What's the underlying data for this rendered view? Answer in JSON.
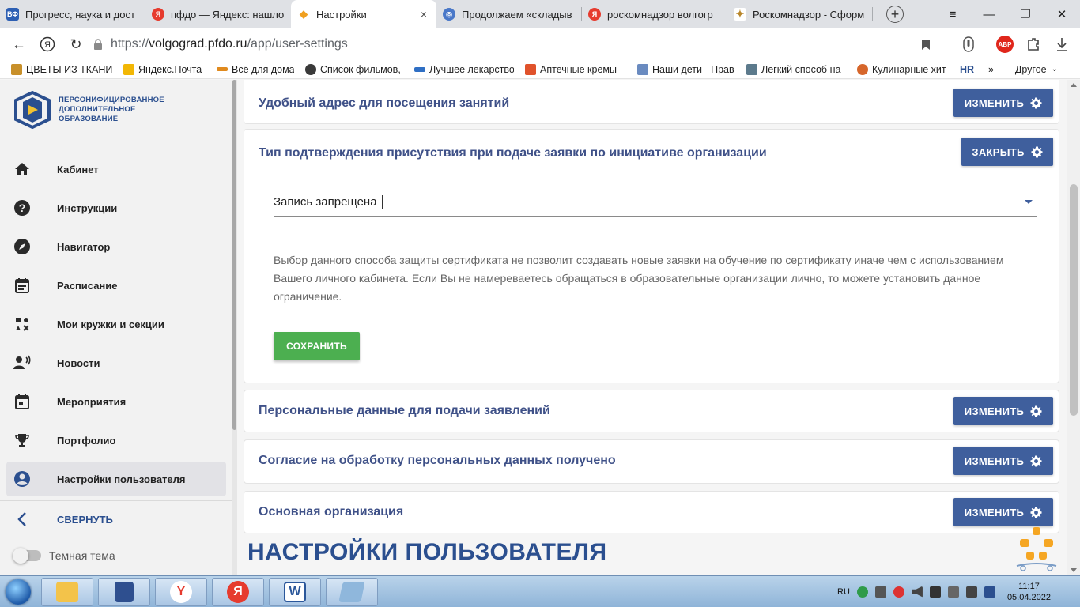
{
  "browser": {
    "tabs": [
      {
        "title": "Прогресс, наука и дост",
        "favicon": "vf-icon",
        "color": "#2d5fb3",
        "glyph": "ВФ"
      },
      {
        "title": "пфдо — Яндекс: нашло",
        "favicon": "yandex-icon",
        "color": "#e63b2e",
        "glyph": "Я"
      },
      {
        "title": "Настройки",
        "favicon": "diamond-icon",
        "color": "#f0a020",
        "glyph": "◆",
        "active": true
      },
      {
        "title": "Продолжаем «складыв",
        "favicon": "globe-icon",
        "color": "#4a78c8",
        "glyph": "◎"
      },
      {
        "title": "роскомнадзор волгогр",
        "favicon": "yandex-icon",
        "color": "#e63b2e",
        "glyph": "Я"
      },
      {
        "title": "Роскомнадзор - Сформ",
        "favicon": "emblem-icon",
        "color": "#b8862a",
        "glyph": "✦"
      }
    ],
    "close_glyph": "×",
    "url_prefix": "https://",
    "url_host": "volgograd.pfdo.ru",
    "url_path": "/app/user-settings",
    "abp_label": "ABP",
    "bookmarks": [
      {
        "label": "ЦВЕТЫ ИЗ ТКАНИ",
        "color": "#c8902a"
      },
      {
        "label": "Яндекс.Почта",
        "color": "#f2b705"
      },
      {
        "label": "Всё для дома",
        "color": "#e08a1e"
      },
      {
        "label": "Список фильмов,",
        "color": "#3a3a3a"
      },
      {
        "label": "Лучшее лекарство",
        "color": "#2f6fc4"
      },
      {
        "label": "Аптечные кремы -",
        "color": "#e0522b"
      },
      {
        "label": "Наши дети - Прав",
        "color": "#6a8bc0"
      },
      {
        "label": "Легкий способ на",
        "color": "#5c7a8c"
      },
      {
        "label": "Кулинарные хит",
        "color": "#d6662b"
      },
      {
        "label": "HR",
        "color": "#2b4f8f"
      }
    ],
    "bookmarks_more": "»",
    "bookmarks_other": "Другое"
  },
  "sidebar": {
    "logo_lines": [
      "ПЕРСОНИФИЦИРОВАННОЕ",
      "ДОПОЛНИТЕЛЬНОЕ",
      "ОБРАЗОВАНИЕ"
    ],
    "items": [
      {
        "label": "Кабинет",
        "icon": "home-icon"
      },
      {
        "label": "Инструкции",
        "icon": "help-icon"
      },
      {
        "label": "Навигатор",
        "icon": "compass-icon"
      },
      {
        "label": "Расписание",
        "icon": "calendar-list-icon"
      },
      {
        "label": "Мои кружки и секции",
        "icon": "toys-icon"
      },
      {
        "label": "Новости",
        "icon": "speaker-person-icon"
      },
      {
        "label": "Мероприятия",
        "icon": "event-icon"
      },
      {
        "label": "Портфолио",
        "icon": "trophy-icon"
      },
      {
        "label": "Настройки пользователя",
        "icon": "account-circle-icon",
        "active": true
      }
    ],
    "collapse_label": "СВЕРНУТЬ",
    "theme_label": "Темная тема"
  },
  "main": {
    "cards": [
      {
        "title": "Удобный адрес для посещения занятий",
        "button": "ИЗМЕНИТЬ"
      },
      {
        "title": "Тип подтверждения присутствия при подаче заявки по инициативе организации",
        "button": "ЗАКРЫТЬ"
      },
      {
        "title": "Персональные данные для подачи заявлений",
        "button": "ИЗМЕНИТЬ"
      },
      {
        "title": "Согласие на обработку персональных данных получено",
        "button": "ИЗМЕНИТЬ"
      },
      {
        "title": "Основная организация",
        "button": "ИЗМЕНИТЬ"
      }
    ],
    "select_value": "Запись запрещена",
    "description": "Выбор данного способа защиты сертификата не позволит создавать новые заявки на обучение по сертификату иначе чем с использованием Вашего личного кабинета. Если Вы не намереваетесь обращаться в образовательные организации лично, то можете установить данное ограничение.",
    "save_label": "СОХРАНИТЬ",
    "page_heading": "НАСТРОЙКИ ПОЛЬЗОВАТЕЛЯ"
  },
  "taskbar": {
    "language": "RU",
    "time": "11:17",
    "date": "05.04.2022"
  },
  "colors": {
    "accent": "#3f5f9d",
    "title": "#3f5188",
    "save": "#4caf50"
  }
}
